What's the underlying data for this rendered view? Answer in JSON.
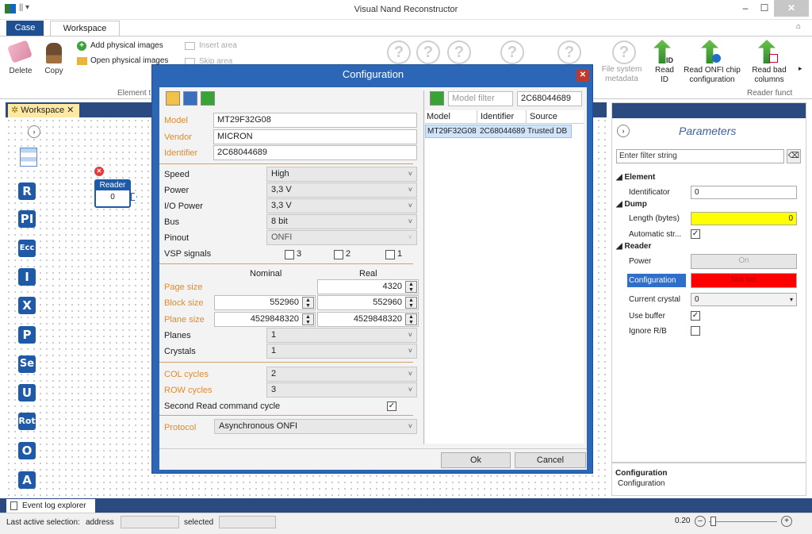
{
  "window": {
    "title": "Visual Nand Reconstructor"
  },
  "tabs": {
    "case": "Case",
    "workspace": "Workspace"
  },
  "ribbon": {
    "delete": "Delete",
    "copy": "Copy",
    "add_images": "Add physical images",
    "open_images": "Open physical images",
    "insert_area": "Insert area",
    "skip_area": "Skip area",
    "element_group": "Element t",
    "fs_meta_1": "File system",
    "fs_meta_2": "metadata",
    "read_id_1": "Read",
    "read_id_2": "ID",
    "read_onfi_1": "Read ONFI chip",
    "read_onfi_2": "configuration",
    "read_bad_1": "Read bad",
    "read_bad_2": "columns",
    "reader_group": "Reader funct",
    "id_badge": "ID"
  },
  "workspace": {
    "tab_label": "Workspace",
    "reader_title": "Reader",
    "reader_value": "0"
  },
  "tools": [
    "R",
    "PI",
    "Ecc",
    "I",
    "X",
    "P",
    "Se",
    "U",
    "Rot",
    "O",
    "A"
  ],
  "dialog": {
    "title": "Configuration",
    "model_label": "Model",
    "model": "MT29F32G08",
    "vendor_label": "Vendor",
    "vendor": "MICRON",
    "identifier_label": "Identifier",
    "identifier": "2C68044689",
    "speed_label": "Speed",
    "speed": "High",
    "power_label": "Power",
    "power": "3,3 V",
    "io_power_label": "I/O Power",
    "io_power": "3,3 V",
    "bus_label": "Bus",
    "bus": "8 bit",
    "pinout_label": "Pinout",
    "pinout": "ONFI",
    "vsp_label": "VSP signals",
    "vsp": [
      "3",
      "2",
      "1"
    ],
    "nominal": "Nominal",
    "real": "Real",
    "page_size_label": "Page size",
    "page_size_real": "4320",
    "block_size_label": "Block size",
    "block_size_nominal": "552960",
    "block_size_real": "552960",
    "plane_size_label": "Plane size",
    "plane_size_nominal": "4529848320",
    "plane_size_real": "4529848320",
    "planes_label": "Planes",
    "planes": "1",
    "crystals_label": "Crystals",
    "crystals": "1",
    "col_cycles_label": "COL cycles",
    "col_cycles": "2",
    "row_cycles_label": "ROW cycles",
    "row_cycles": "3",
    "second_read_label": "Second Read command cycle",
    "protocol_label": "Protocol",
    "protocol": "Asynchronous ONFI",
    "model_filter_placeholder": "Model filter",
    "model_filter_value": "2C68044689",
    "table_headers": [
      "Model",
      "Identifier",
      "Source"
    ],
    "table_rows": [
      [
        "MT29F32G08",
        "2C68044689",
        "Trusted DB"
      ]
    ],
    "ok": "Ok",
    "cancel": "Cancel"
  },
  "params": {
    "title": "Parameters",
    "filter_placeholder": "Enter filter string",
    "element": "Element",
    "identificator_label": "Identificator",
    "identificator": "0",
    "dump": "Dump",
    "length_label": "Length (bytes)",
    "length": "0",
    "auto_label": "Automatic str...",
    "reader": "Reader",
    "power_label": "Power",
    "power": "On",
    "config_label": "Configuration",
    "config": "Not set",
    "crystal_label": "Current crystal",
    "crystal": "0",
    "buffer_label": "Use buffer",
    "ignore_label": "Ignore R/B",
    "desc_title": "Configuration",
    "desc_text": "Configuration",
    "colors": {
      "highlight_yellow": "#ffff00",
      "error_red": "#ff0000"
    }
  },
  "status": {
    "event_log": "Event log explorer",
    "last_sel": "Last active selection:",
    "address": "address",
    "selected": "selected",
    "zoom": "0.20"
  }
}
